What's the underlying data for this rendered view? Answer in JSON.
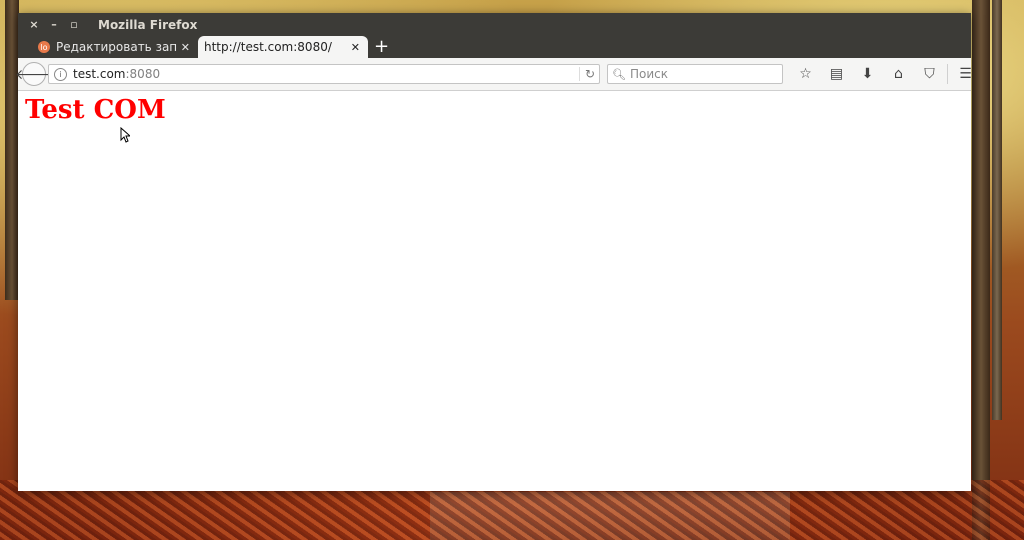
{
  "window": {
    "title": "Mozilla Firefox",
    "controls": {
      "close": "×",
      "minimize": "–",
      "maximize": "▫"
    }
  },
  "tabs": [
    {
      "label": "Редактировать зап...",
      "favicon": "lo",
      "active": false
    },
    {
      "label": "http://test.com:8080/",
      "active": true
    }
  ],
  "new_tab": "+",
  "toolbar": {
    "url_host": "test.com",
    "url_port": ":8080",
    "search_placeholder": "Поиск",
    "icons": [
      "bookmark-star-icon",
      "reading-list-icon",
      "download-icon",
      "home-icon",
      "pocket-icon",
      "menu-icon"
    ]
  },
  "page": {
    "heading": "Test COM",
    "heading_color": "#ff0000"
  }
}
